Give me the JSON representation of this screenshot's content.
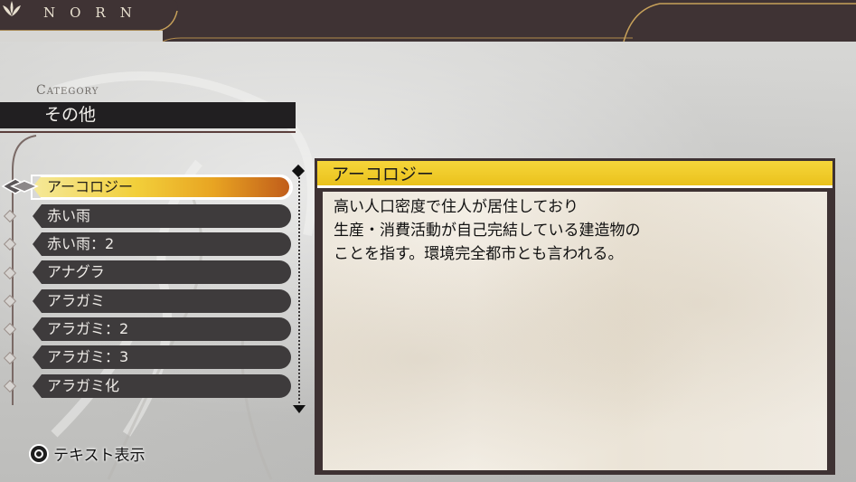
{
  "header": {
    "logo_text": "NORN"
  },
  "category": {
    "label": "Category",
    "value": "その他"
  },
  "list": {
    "items": [
      {
        "label": "アーコロジー",
        "selected": true
      },
      {
        "label": "赤い雨",
        "selected": false
      },
      {
        "label": "赤い雨：2",
        "selected": false
      },
      {
        "label": "アナグラ",
        "selected": false
      },
      {
        "label": "アラガミ",
        "selected": false
      },
      {
        "label": "アラガミ：2",
        "selected": false
      },
      {
        "label": "アラガミ：3",
        "selected": false
      },
      {
        "label": "アラガミ化",
        "selected": false
      }
    ]
  },
  "detail": {
    "title": "アーコロジー",
    "lines": [
      "高い人口密度で住人が居住しており",
      "生産・消費活動が自己完結している建造物の",
      "ことを指す。環境完全都市とも言われる。"
    ]
  },
  "footer": {
    "hint_text": "テキスト表示",
    "hint_icon": "circle-button-icon"
  },
  "colors": {
    "accent_yellow": "#f2cf3a",
    "bar_dark": "#3e3233",
    "item_dark": "#3e3b3c"
  }
}
